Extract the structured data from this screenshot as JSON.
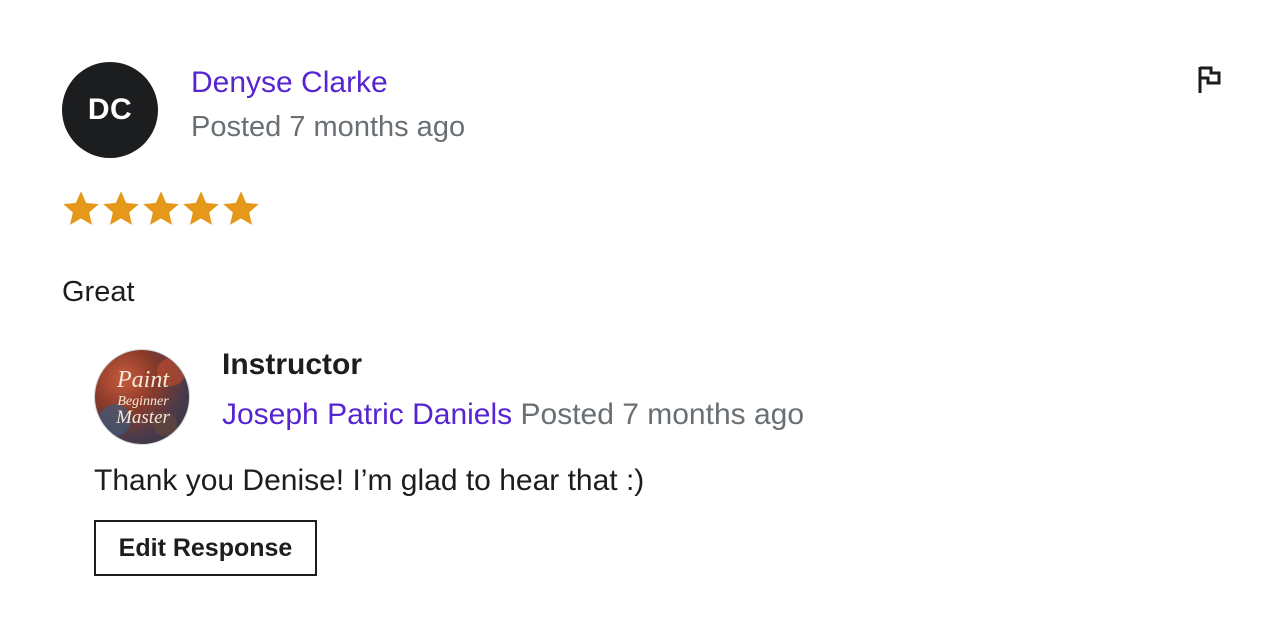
{
  "review": {
    "avatar_initials": "DC",
    "reviewer_name": "Denyse Clarke",
    "posted": "Posted 7 months ago",
    "rating": 5,
    "rating_max": 5,
    "star_color": "#e59819",
    "text": "Great"
  },
  "response": {
    "role_label": "Instructor",
    "instructor_name": "Joseph Patric Daniels",
    "posted": "Posted 7 months ago",
    "avatar_logo_lines": [
      "Paint",
      "Beginner",
      "Master"
    ],
    "text": "Thank you Denise! I’m glad to hear that :)",
    "edit_button_label": "Edit Response"
  },
  "colors": {
    "link": "#5624d0",
    "muted": "#6a6f73",
    "text": "#1c1d1f"
  }
}
